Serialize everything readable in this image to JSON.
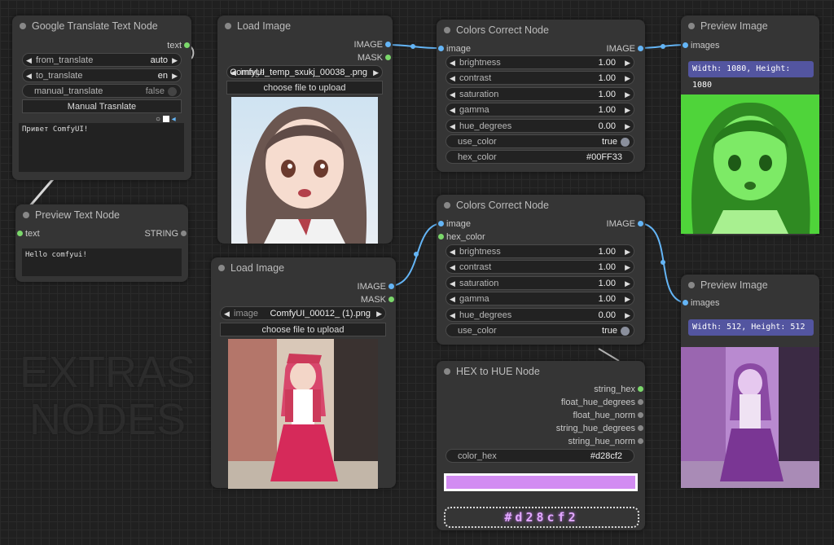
{
  "background_text": [
    "EXTRAS",
    "NODES"
  ],
  "google_translate": {
    "title": "Google Translate Text Node",
    "output_text": "text",
    "from_label": "from_translate",
    "from_value": "auto",
    "to_label": "to_translate",
    "to_value": "en",
    "manual_label": "manual_translate",
    "manual_value": "false",
    "button": "Manual Trasnlate",
    "textarea": "Привет ComfyUI!"
  },
  "preview_text": {
    "title": "Preview Text Node",
    "input_text": "text",
    "output_string": "STRING",
    "textarea": "Hello comfyui!"
  },
  "load_image_1": {
    "title": "Load Image",
    "out_image": "IMAGE",
    "out_mask": "MASK",
    "image_label": "image",
    "image_value": "ComfyUI_temp_sxukj_00038_.png",
    "upload": "choose file to upload"
  },
  "load_image_2": {
    "title": "Load Image",
    "out_image": "IMAGE",
    "out_mask": "MASK",
    "image_label": "image",
    "image_value": "ComfyUI_00012_ (1).png",
    "upload": "choose file to upload"
  },
  "colors_1": {
    "title": "Colors Correct Node",
    "in_image": "image",
    "out_image": "IMAGE",
    "brightness_label": "brightness",
    "brightness": "1.00",
    "contrast_label": "contrast",
    "contrast": "1.00",
    "saturation_label": "saturation",
    "saturation": "1.00",
    "gamma_label": "gamma",
    "gamma": "1.00",
    "hue_label": "hue_degrees",
    "hue": "0.00",
    "use_color_label": "use_color",
    "use_color": "true",
    "hex_label": "hex_color",
    "hex": "#00FF33"
  },
  "colors_2": {
    "title": "Colors Correct Node",
    "in_image": "image",
    "in_hex": "hex_color",
    "out_image": "IMAGE",
    "brightness_label": "brightness",
    "brightness": "1.00",
    "contrast_label": "contrast",
    "contrast": "1.00",
    "saturation_label": "saturation",
    "saturation": "1.00",
    "gamma_label": "gamma",
    "gamma": "1.00",
    "hue_label": "hue_degrees",
    "hue": "0.00",
    "use_color_label": "use_color",
    "use_color": "true"
  },
  "preview_1": {
    "title": "Preview Image",
    "in_images": "images",
    "size": "Width: 1080, Height: 1080"
  },
  "preview_2": {
    "title": "Preview Image",
    "in_images": "images",
    "size": "Width: 512, Height: 512"
  },
  "hex_hue": {
    "title": "HEX to HUE Node",
    "out1": "string_hex",
    "out2": "float_hue_degrees",
    "out3": "float_hue_norm",
    "out4": "string_hue_degrees",
    "out5": "string_hue_norm",
    "color_label": "color_hex",
    "color_value": "#d28cf2",
    "swatch": "#d28cf2",
    "display": "#d28cf2"
  },
  "colors": {
    "link_blue": "#64b5f6",
    "link_green": "#9acd7a",
    "link_grey": "#9a9a9a",
    "accent_purple": "#d28cf2",
    "green_tint": "#00FF33",
    "size_bar": "#5355a0"
  }
}
